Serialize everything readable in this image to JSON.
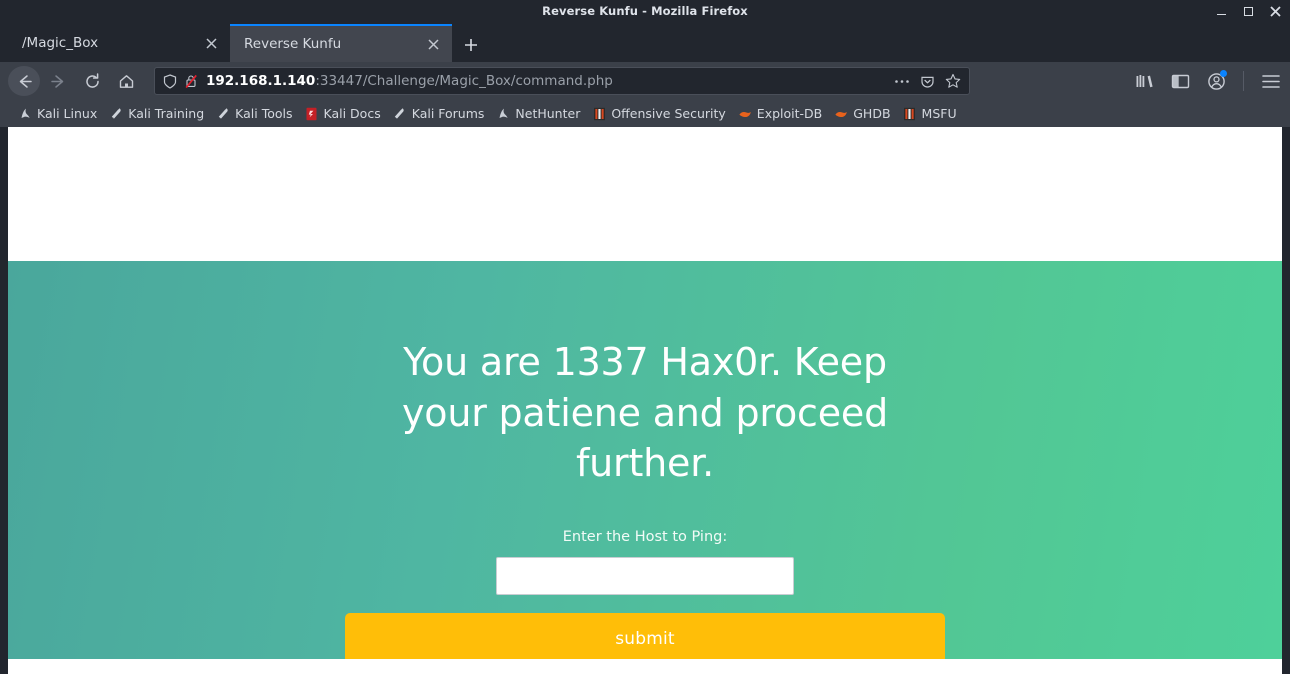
{
  "window": {
    "title": "Reverse Kunfu - Mozilla Firefox",
    "controls": {
      "minimize": "minimize-button",
      "maximize": "maximize-button",
      "close": "close-button"
    }
  },
  "tabs": [
    {
      "label": "/Magic_Box",
      "active": false,
      "close_label": "✕"
    },
    {
      "label": "Reverse Kunfu",
      "active": true,
      "close_label": "✕"
    }
  ],
  "newtab_label": "+",
  "toolbar": {
    "back_icon": "back-arrow-icon",
    "forward_icon": "forward-arrow-icon",
    "reload_icon": "reload-icon",
    "home_icon": "home-icon",
    "library_icon": "library-icon",
    "sidebar_icon": "sidebar-toggle-icon",
    "account_icon": "account-avatar-icon",
    "menu_icon": "hamburger-menu-icon"
  },
  "urlbar": {
    "host": "192.168.1.140",
    "path": ":33447/Challenge/Magic_Box/command.php",
    "full_url": "192.168.1.140:33447/Challenge/Magic_Box/command.php",
    "shield_icon": "tracking-protection-shield-icon",
    "insecure_icon": "insecure-connection-crossed-padlock-icon",
    "more_icon": "page-actions-ellipsis-icon",
    "pocket_icon": "save-to-pocket-icon",
    "bookmark_icon": "bookmark-star-icon"
  },
  "bookmarks": [
    {
      "label": "Kali Linux",
      "icon": "kali-dragon-icon",
      "icon_type": "dragon"
    },
    {
      "label": "Kali Training",
      "icon": "kali-wrench-icon",
      "icon_type": "wrench"
    },
    {
      "label": "Kali Tools",
      "icon": "kali-wrench-icon",
      "icon_type": "wrench"
    },
    {
      "label": "Kali Docs",
      "icon": "kali-docs-book-icon",
      "icon_type": "redbook"
    },
    {
      "label": "Kali Forums",
      "icon": "kali-wrench-icon",
      "icon_type": "wrench"
    },
    {
      "label": "NetHunter",
      "icon": "kali-dragon-icon",
      "icon_type": "dragon"
    },
    {
      "label": "Offensive Security",
      "icon": "offsec-logo-icon",
      "icon_type": "offsec"
    },
    {
      "label": "Exploit-DB",
      "icon": "exploit-db-flame-icon",
      "icon_type": "flame"
    },
    {
      "label": "GHDB",
      "icon": "exploit-db-flame-icon",
      "icon_type": "flame"
    },
    {
      "label": "MSFU",
      "icon": "offsec-logo-icon",
      "icon_type": "offsec"
    }
  ],
  "page": {
    "heading": "You are 1337 Hax0r. Keep your patiene and proceed further.",
    "form": {
      "label": "Enter the Host to Ping:",
      "input_value": "",
      "input_placeholder": "",
      "submit_label": "submit"
    },
    "colors": {
      "hero_gradient_start": "#4aa79c",
      "hero_gradient_end": "#4ed09a",
      "submit_button": "#ffbe08",
      "heading_text": "#ffffff"
    }
  }
}
